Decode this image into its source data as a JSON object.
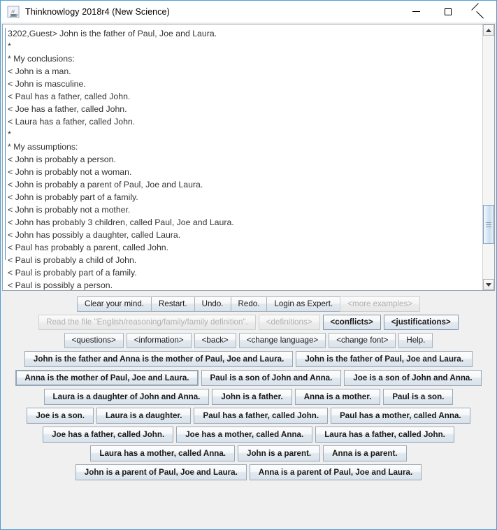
{
  "window": {
    "title": "Thinknowlogy 2018r4 (New Science)",
    "icon": "java-coffee-cup-icon",
    "controls": {
      "minimize": "minimize-icon",
      "maximize": "maximize-icon",
      "close": "close-icon"
    }
  },
  "console": {
    "lines": [
      "3202,Guest> John is the father of Paul, Joe and Laura.",
      "*",
      "* My conclusions:",
      "< John is a man.",
      "< John is masculine.",
      "< Paul has a father, called John.",
      "< Joe has a father, called John.",
      "< Laura has a father, called John.",
      "*",
      "* My assumptions:",
      "< John is probably a person.",
      "< John is probably not a woman.",
      "< John is probably a parent of Paul, Joe and Laura.",
      "< John is probably part of a family.",
      "< John is probably not a mother.",
      "< John has probably 3 children, called Paul, Joe and Laura.",
      "< John has possibly a daughter, called Laura.",
      "< Paul has probably a parent, called John.",
      "< Paul is probably a child of John.",
      "< Paul is probably part of a family.",
      "< Paul is possibly a person."
    ],
    "scrollbar": {
      "up_arrow": "scroll-up-icon",
      "down_arrow": "scroll-down-icon"
    }
  },
  "controls": {
    "row1": [
      {
        "label": "Clear your mind.",
        "disabled": false
      },
      {
        "label": "Restart.",
        "disabled": false
      },
      {
        "label": "Undo.",
        "disabled": false
      },
      {
        "label": "Redo.",
        "disabled": false
      },
      {
        "label": "Login as Expert.",
        "disabled": false
      },
      {
        "label": "<more examples>",
        "disabled": true
      }
    ],
    "row2": [
      {
        "label": "Read the file \"English/reasoning/family/family definition\".",
        "disabled": true,
        "bold": false
      },
      {
        "label": "<definitions>",
        "disabled": true,
        "bold": false
      },
      {
        "label": "<conflicts>",
        "disabled": false,
        "bold": true
      },
      {
        "label": "<justifications>",
        "disabled": false,
        "bold": true
      }
    ],
    "row3": [
      {
        "label": "<questions>",
        "disabled": false
      },
      {
        "label": "<information>",
        "disabled": false
      },
      {
        "label": "<back>",
        "disabled": false
      },
      {
        "label": "<change language>",
        "disabled": false
      },
      {
        "label": "<change font>",
        "disabled": false
      },
      {
        "label": "Help.",
        "disabled": false
      }
    ]
  },
  "suggestions": {
    "rows": [
      [
        {
          "label": "John is the father and Anna is the mother of Paul, Joe and Laura.",
          "focused": false
        },
        {
          "label": "John is the father of Paul, Joe and Laura.",
          "focused": false
        }
      ],
      [
        {
          "label": "Anna is the mother of Paul, Joe and Laura.",
          "focused": true
        },
        {
          "label": "Paul is a son of John and Anna.",
          "focused": false
        },
        {
          "label": "Joe is a son of John and Anna.",
          "focused": false
        }
      ],
      [
        {
          "label": "Laura is a daughter of John and Anna.",
          "focused": false
        },
        {
          "label": "John is a father.",
          "focused": false
        },
        {
          "label": "Anna is a mother.",
          "focused": false
        },
        {
          "label": "Paul is a son.",
          "focused": false
        }
      ],
      [
        {
          "label": "Joe is a son.",
          "focused": false
        },
        {
          "label": "Laura is a daughter.",
          "focused": false
        },
        {
          "label": "Paul has a father, called John.",
          "focused": false
        },
        {
          "label": "Paul has a mother, called Anna.",
          "focused": false
        }
      ],
      [
        {
          "label": "Joe has a father, called John.",
          "focused": false
        },
        {
          "label": "Joe has a mother, called Anna.",
          "focused": false
        },
        {
          "label": "Laura has a father, called John.",
          "focused": false
        }
      ],
      [
        {
          "label": "Laura has a mother, called Anna.",
          "focused": false
        },
        {
          "label": "John is a parent.",
          "focused": false
        },
        {
          "label": "Anna is a parent.",
          "focused": false
        }
      ],
      [
        {
          "label": "John is a parent of Paul, Joe and Laura.",
          "focused": false
        },
        {
          "label": "Anna is a parent of Paul, Joe and Laura.",
          "focused": false
        }
      ]
    ]
  },
  "colors": {
    "window_border": "#4a9fd4",
    "panel_bg": "#f0f0f0",
    "text_color": "#333333",
    "caret": "#3f8fc4"
  }
}
